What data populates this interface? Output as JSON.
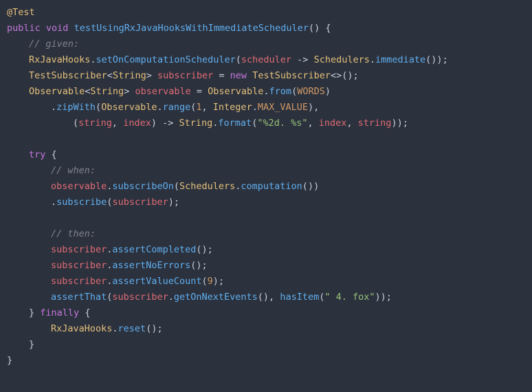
{
  "code": {
    "annotation": "@Test",
    "kw_public": "public",
    "kw_void": "void",
    "kw_new": "new",
    "kw_try": "try",
    "kw_finally": "finally",
    "method_name": "testUsingRxJavaHooksWithImmediateScheduler",
    "cmt_given": "// given:",
    "cmt_when": "// when:",
    "cmt_then": "// then:",
    "RxJavaHooks": "RxJavaHooks",
    "setOnComputationScheduler": "setOnComputationScheduler",
    "scheduler": "scheduler",
    "arrow": " -> ",
    "Schedulers": "Schedulers",
    "immediate": "immediate",
    "TestSubscriber": "TestSubscriber",
    "String": "String",
    "subscriber": "subscriber",
    "Observable": "Observable",
    "observable": "observable",
    "from": "from",
    "WORDS": "WORDS",
    "zipWith": "zipWith",
    "range": "range",
    "Integer": "Integer",
    "MAX_VALUE": "MAX_VALUE",
    "stringp": "string",
    "indexp": "index",
    "format": "format",
    "fmt_str": "\"%2d. %s\"",
    "subscribeOn": "subscribeOn",
    "computation": "computation",
    "subscribe": "subscribe",
    "assertCompleted": "assertCompleted",
    "assertNoErrors": "assertNoErrors",
    "assertValueCount": "assertValueCount",
    "nine": "9",
    "one": "1",
    "assertThat": "assertThat",
    "getOnNextEvents": "getOnNextEvents",
    "hasItem": "hasItem",
    "fox_str": "\" 4. fox\"",
    "reset": "reset",
    "lt": "<",
    "gt": ">",
    "gen_empty": "<>",
    "op": "(",
    "cp": ")",
    "ob": "{",
    "cb": "}",
    "semi": ";",
    "dot": ".",
    "comma": ", ",
    "eq": " = "
  }
}
